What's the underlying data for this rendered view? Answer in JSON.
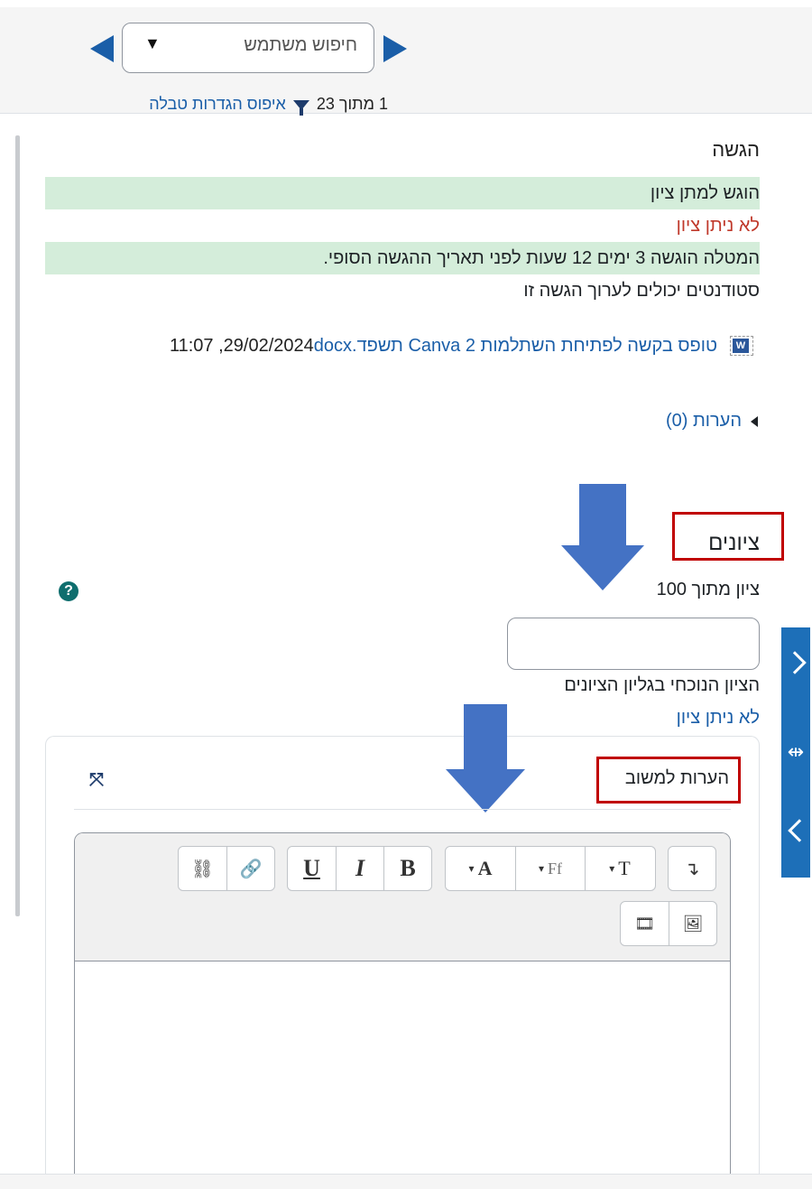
{
  "navigation": {
    "user_search_placeholder": "חיפוש משתמש",
    "dropdown_glyph": "▼",
    "count_text": "1 מתוך 23",
    "reset_link": "איפוס הגדרות טבלה"
  },
  "submission": {
    "title": "הגשה",
    "status_submitted": "הוגש למתן ציון",
    "status_not_graded": "לא ניתן ציון",
    "timing_note": "המטלה הוגשה 3 ימים 12 שעות לפני תאריך ההגשה הסופי.",
    "edit_note": "סטודנטים יכולים לערוך הגשה זו",
    "file": {
      "icon": "word-doc-icon",
      "name": "טופס בקשה לפתיחת השתלמות 2 Canva תשפד.docx",
      "date": "29/02/2024, 11:07"
    },
    "comments_toggle": "הערות (0)"
  },
  "grades": {
    "title": "ציונים",
    "out_of_label": "ציון מתוך 100",
    "grade_value": "",
    "current_grade_label": "הציון הנוכחי בגליון הציונים",
    "current_grade_value": "לא ניתן ציון"
  },
  "feedback": {
    "title": "הערות למשוב",
    "toolbar": {
      "bold": "B",
      "italic": "I",
      "underline": "U",
      "font_color": "A",
      "font_family": "Ff",
      "font_size": "T",
      "caret": "▾",
      "direction": "↴",
      "link_icon": "link-icon",
      "unlink_icon": "unlink-icon",
      "image_icon": "image-icon",
      "media_icon": "media-icon"
    },
    "content": ""
  },
  "colors": {
    "accent": "#1a5ea8",
    "green_highlight": "#d4edda",
    "red_text": "#c0392b",
    "annotation_red": "#c00000",
    "annotation_arrow": "#4472c4",
    "side_panel": "#1d6fb8"
  }
}
